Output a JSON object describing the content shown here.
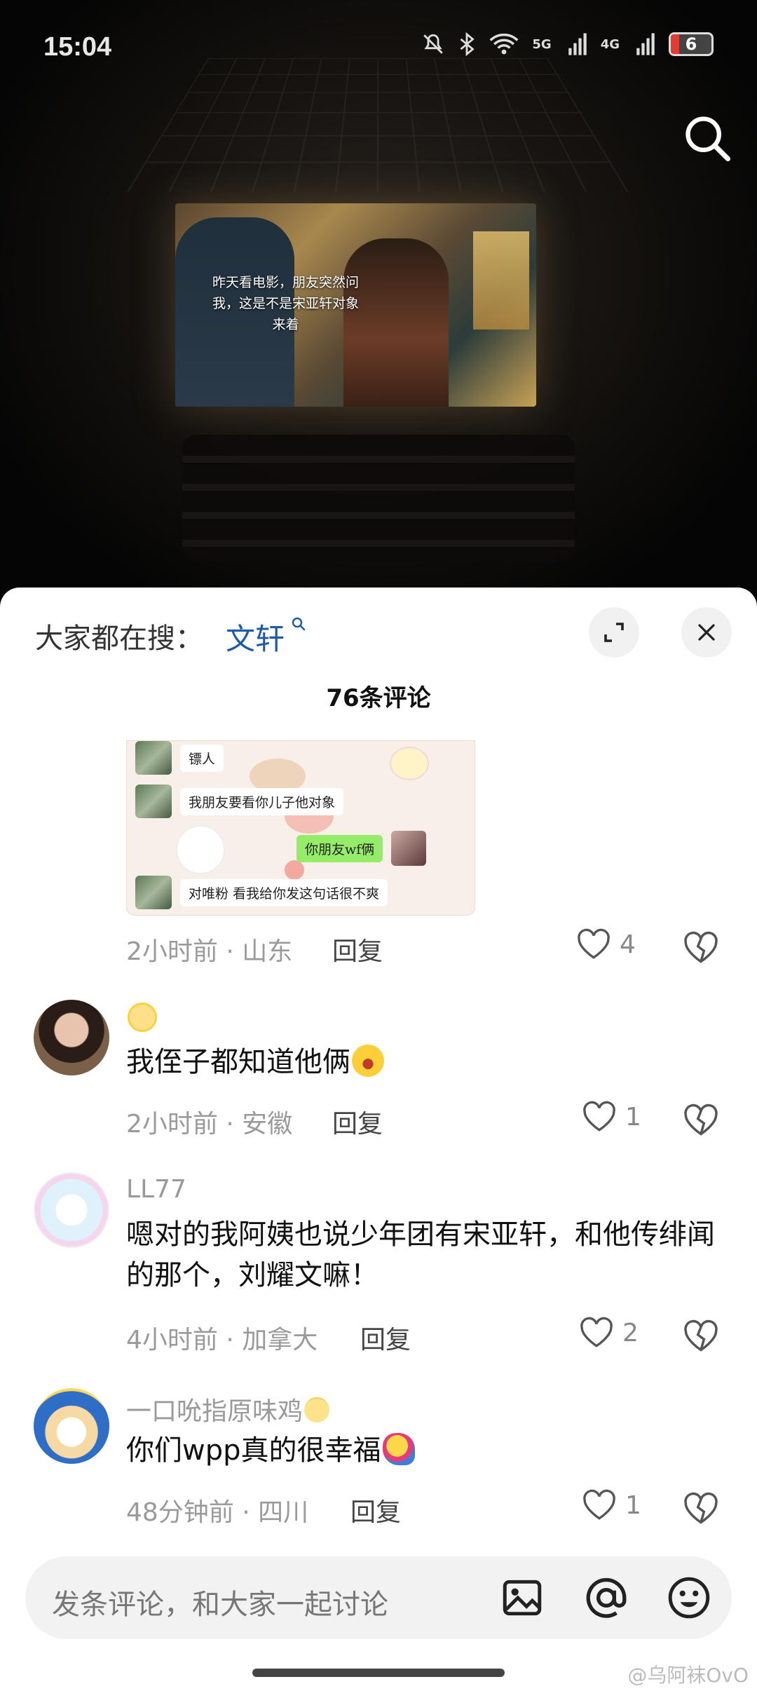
{
  "status_bar": {
    "time": "15:04",
    "network_5g": "5G",
    "network_4g": "4G",
    "battery": "6"
  },
  "video": {
    "caption": "昨天看电影，朋友突然问我，这是不是宋亚轩对象来着"
  },
  "sheet": {
    "hot_search_prefix": "大家都在搜：",
    "hot_search_term": "文轩",
    "comment_count_title": "76条评论"
  },
  "chat_image": {
    "lines": [
      "镖人",
      "我朋友要看你儿子他对象",
      "你朋友wf俩",
      "对唯粉 看我给你发这句话很不爽"
    ]
  },
  "comments": [
    {
      "meta": "2小时前 · 山东",
      "reply_label": "回复",
      "likes": "4"
    },
    {
      "username": "",
      "text": "我侄子都知道他俩",
      "meta": "2小时前 · 安徽",
      "reply_label": "回复",
      "likes": "1"
    },
    {
      "username": "LL77",
      "text": "嗯对的我阿姨也说少年团有宋亚轩，和他传绯闻的那个，刘耀文嘛！",
      "meta": "4小时前 · 加拿大",
      "reply_label": "回复",
      "likes": "2"
    },
    {
      "username": "一口吮指原味鸡",
      "text": "你们wpp真的很幸福",
      "meta": "48分钟前 · 四川",
      "reply_label": "回复",
      "likes": "1"
    }
  ],
  "input_bar": {
    "placeholder": "发条评论，和大家一起讨论"
  },
  "watermark": "@乌阿袜OvO",
  "icons": [
    "mute-icon",
    "bluetooth-icon",
    "wifi-icon",
    "signal-icon",
    "search-icon",
    "expand-icon",
    "close-icon",
    "heart-icon",
    "broken-heart-icon",
    "image-icon",
    "at-icon",
    "emoji-icon"
  ]
}
